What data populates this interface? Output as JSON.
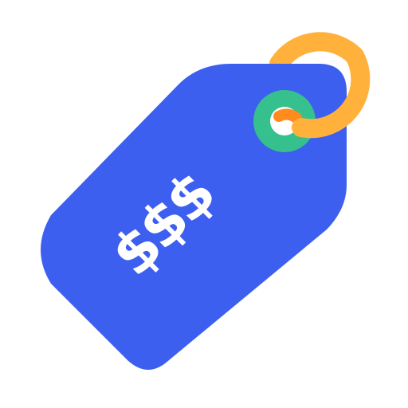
{
  "icon": {
    "name": "price-tag-icon",
    "label": "$$$"
  },
  "colors": {
    "background": "#ffffff",
    "tag": "#3d5ff0",
    "tag_text": "#ffffff",
    "eyelet": "#36c08e",
    "ring": "#ffb13b",
    "ring_shadow": "#ff8a1d"
  }
}
